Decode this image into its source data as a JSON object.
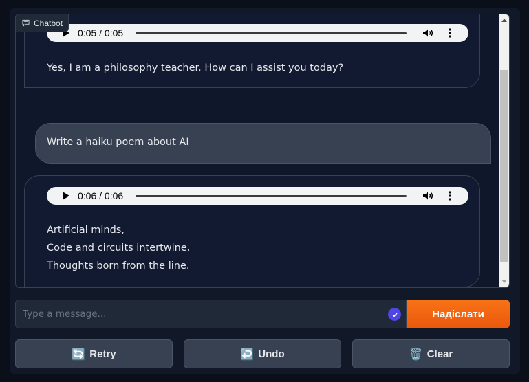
{
  "chatbot": {
    "label": "Chatbot",
    "messages": [
      {
        "role": "bot",
        "audio_time": "0:05 / 0:05",
        "lines": [
          "Yes, I am a philosophy teacher. How can I assist you today?"
        ]
      },
      {
        "role": "user",
        "lines": [
          "Write a haiku poem about AI"
        ]
      },
      {
        "role": "bot",
        "audio_time": "0:06 / 0:06",
        "lines": [
          "Artificial minds,",
          "Code and circuits intertwine,",
          "Thoughts born from the line."
        ]
      }
    ]
  },
  "input": {
    "placeholder": "Type a message...",
    "value": ""
  },
  "send_button": {
    "label": "Надіслати"
  },
  "buttons": {
    "retry": {
      "icon": "🔄",
      "label": "Retry"
    },
    "undo": {
      "icon": "↩️",
      "label": "Undo"
    },
    "clear": {
      "icon": "🗑️",
      "label": "Clear"
    }
  },
  "colors": {
    "background": "#0b0f19",
    "panel": "#111827",
    "accent": "#f97316",
    "user_bubble": "#374151"
  }
}
